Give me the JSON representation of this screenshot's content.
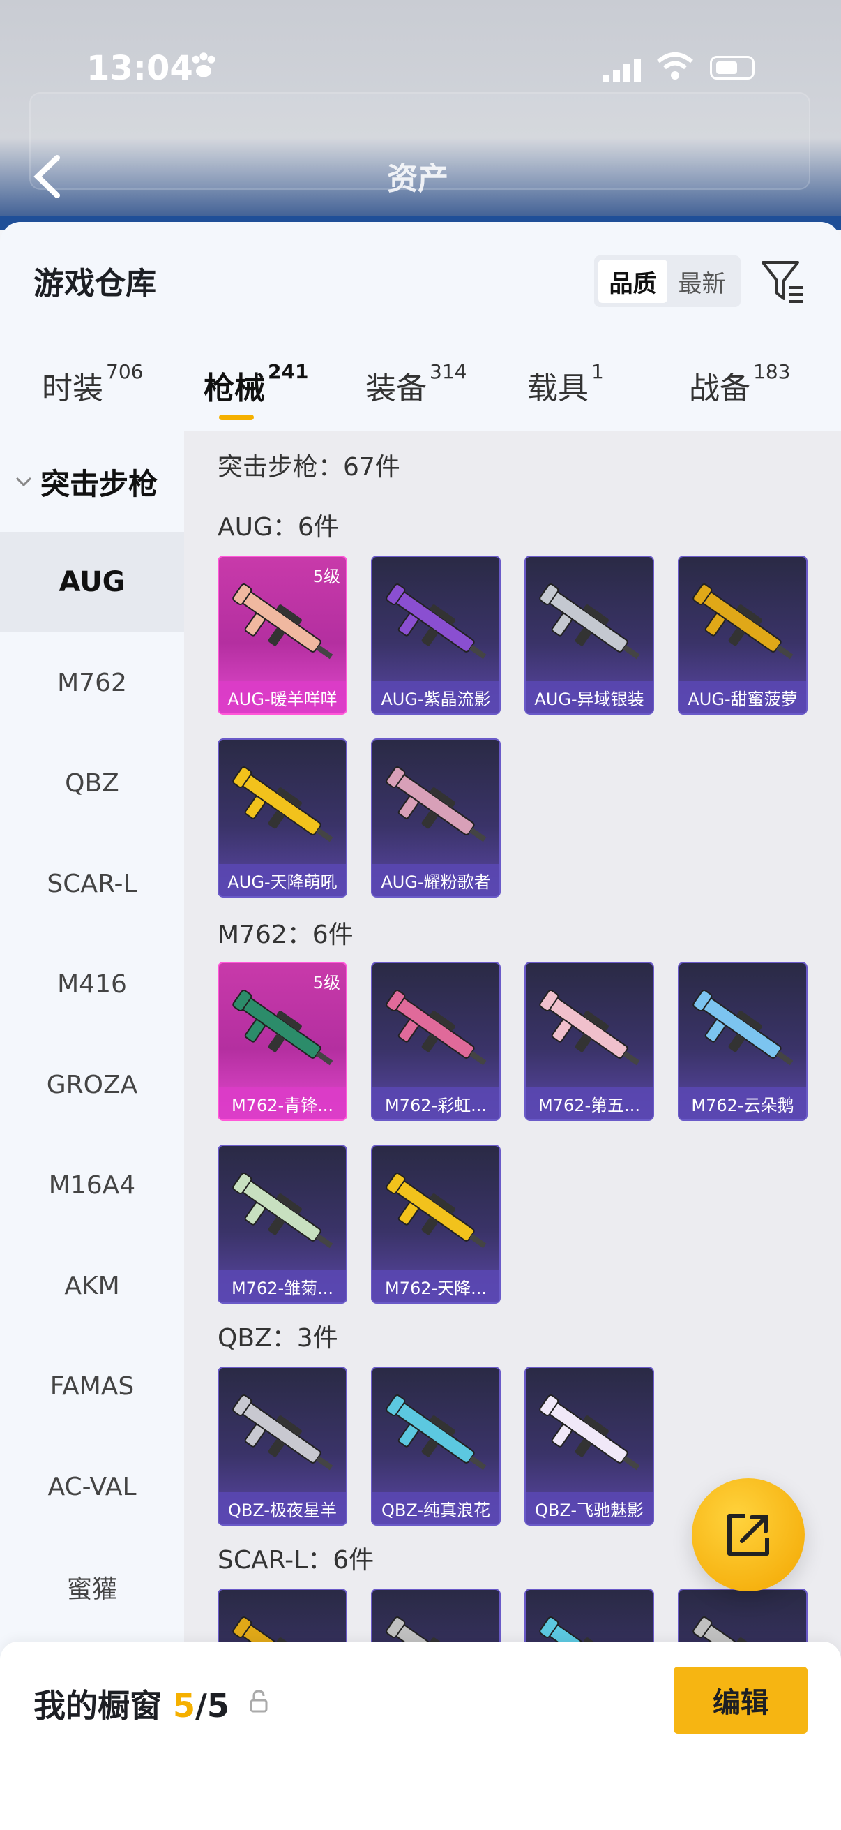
{
  "status": {
    "time": "13:04"
  },
  "header": {
    "title": "游戏仓库",
    "sort_quality": "品质",
    "sort_latest": "最新",
    "ghost_title": "资产"
  },
  "tabs": [
    {
      "label": "时装",
      "count": "706"
    },
    {
      "label": "枪械",
      "count": "241"
    },
    {
      "label": "装备",
      "count": "314"
    },
    {
      "label": "载具",
      "count": "1"
    },
    {
      "label": "战备",
      "count": "183"
    }
  ],
  "sidebar": {
    "category": "突击步枪",
    "items": [
      "AUG",
      "M762",
      "QBZ",
      "SCAR-L",
      "M416",
      "GROZA",
      "M16A4",
      "AKM",
      "FAMAS",
      "AC-VAL",
      "蜜獾"
    ]
  },
  "main": {
    "total_label": "突击步枪：67件",
    "sections": [
      {
        "label": "AUG：6件",
        "items": [
          {
            "name": "AUG-暖羊咩咩",
            "level": "5级",
            "rarity": "pink",
            "color": "#f0b8a0"
          },
          {
            "name": "AUG-紫晶流影",
            "level": "",
            "rarity": "purple",
            "color": "#8a4fd1"
          },
          {
            "name": "AUG-异域银装",
            "level": "",
            "rarity": "purple",
            "color": "#c4c8d0"
          },
          {
            "name": "AUG-甜蜜菠萝",
            "level": "",
            "rarity": "purple",
            "color": "#e0a818"
          },
          {
            "name": "AUG-天降萌吼",
            "level": "",
            "rarity": "purple",
            "color": "#f2c21c"
          },
          {
            "name": "AUG-耀粉歌者",
            "level": "",
            "rarity": "purple",
            "color": "#d8a0b8"
          }
        ]
      },
      {
        "label": "M762：6件",
        "items": [
          {
            "name": "M762-青锋...",
            "level": "5级",
            "rarity": "pink",
            "color": "#2c8c6a"
          },
          {
            "name": "M762-彩虹...",
            "level": "",
            "rarity": "purple",
            "color": "#e06a9a"
          },
          {
            "name": "M762-第五...",
            "level": "",
            "rarity": "purple",
            "color": "#f0c0cc"
          },
          {
            "name": "M762-云朵鹅",
            "level": "",
            "rarity": "purple",
            "color": "#7cc4f0"
          },
          {
            "name": "M762-雏菊...",
            "level": "",
            "rarity": "purple",
            "color": "#c8e0c0"
          },
          {
            "name": "M762-天降...",
            "level": "",
            "rarity": "purple",
            "color": "#f2c21c"
          }
        ]
      },
      {
        "label": "QBZ：3件",
        "items": [
          {
            "name": "QBZ-极夜星羊",
            "level": "",
            "rarity": "purple",
            "color": "#c8c8d0"
          },
          {
            "name": "QBZ-纯真浪花",
            "level": "",
            "rarity": "purple",
            "color": "#5cc8e0"
          },
          {
            "name": "QBZ-飞驰魅影",
            "level": "",
            "rarity": "purple",
            "color": "#f0e8f8"
          }
        ]
      },
      {
        "label": "SCAR-L：6件",
        "items": [
          {
            "name": "",
            "level": "",
            "rarity": "purple",
            "color": "#e0a818"
          },
          {
            "name": "",
            "level": "",
            "rarity": "purple",
            "color": "#c0c0c0"
          },
          {
            "name": "",
            "level": "",
            "rarity": "purple",
            "color": "#5cc8e0"
          },
          {
            "name": "",
            "level": "",
            "rarity": "purple",
            "color": "#c0c0c0"
          }
        ]
      }
    ]
  },
  "bottom": {
    "label": "我的橱窗",
    "count": "5",
    "total": "/5",
    "edit": "编辑"
  },
  "colors": {
    "accent": "#f5b000",
    "purple_card": "#5b47a7",
    "pink_card": "#e44ad0"
  }
}
